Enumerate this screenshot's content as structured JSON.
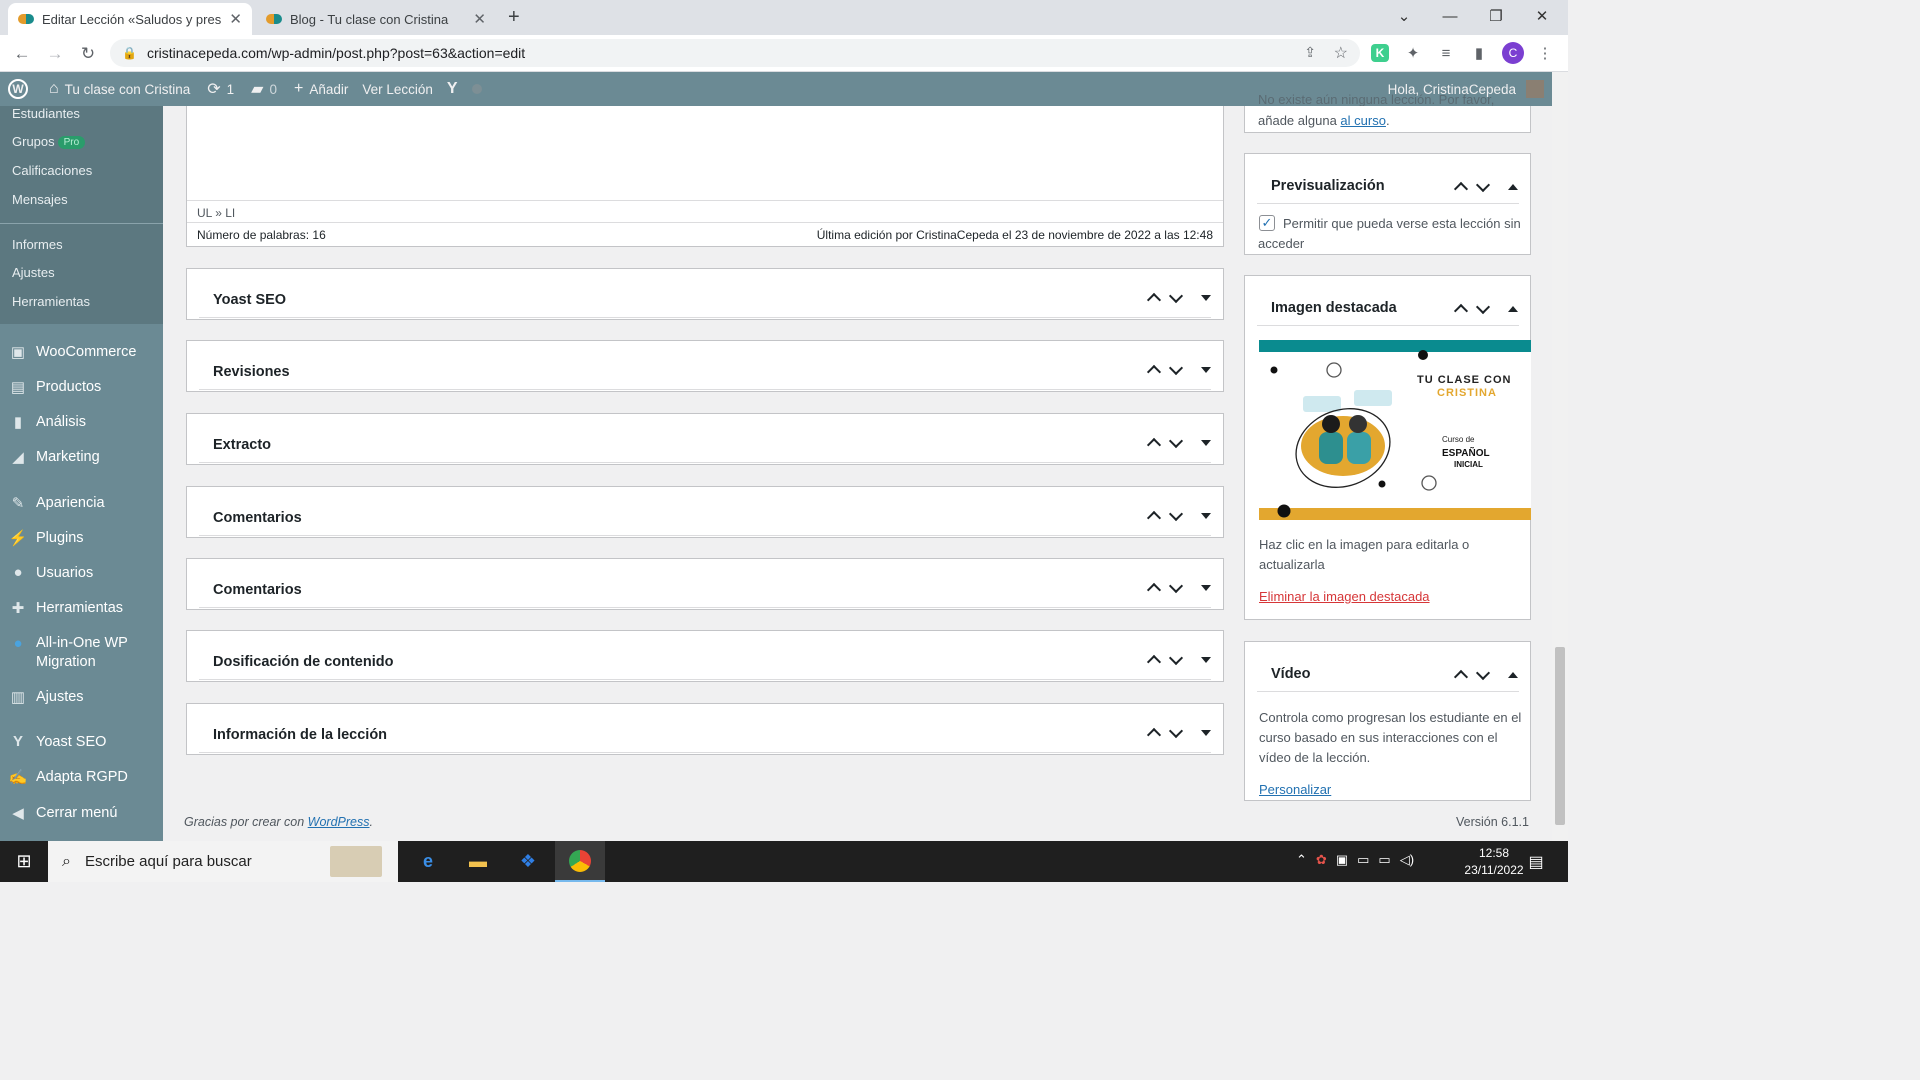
{
  "browser": {
    "tabs": [
      {
        "title": "Editar Lección «Saludos y presen",
        "active": true
      },
      {
        "title": "Blog - Tu clase con Cristina",
        "active": false
      }
    ],
    "url": "cristinacepeda.com/wp-admin/post.php?post=63&action=edit",
    "profile_initial": "C"
  },
  "adminbar": {
    "site": "Tu clase con Cristina",
    "updates": "1",
    "comments": "0",
    "add": "Añadir",
    "view": "Ver Lección",
    "greeting": "Hola, CristinaCepeda"
  },
  "sidebar": {
    "submenu": [
      "Estudiantes",
      "Grupos",
      "Calificaciones",
      "Mensajes",
      "Informes",
      "Ajustes",
      "Herramientas"
    ],
    "pro_badge": "Pro",
    "menu": [
      {
        "label": "WooCommerce",
        "icon": "woo-icon"
      },
      {
        "label": "Productos",
        "icon": "archive-icon"
      },
      {
        "label": "Análisis",
        "icon": "chart-icon"
      },
      {
        "label": "Marketing",
        "icon": "megaphone-icon"
      },
      {
        "label": "Apariencia",
        "icon": "brush-icon"
      },
      {
        "label": "Plugins",
        "icon": "plug-icon"
      },
      {
        "label": "Usuarios",
        "icon": "user-icon"
      },
      {
        "label": "Herramientas",
        "icon": "wrench-icon"
      },
      {
        "label": "All-in-One WP Migration",
        "icon": "circle-icon"
      },
      {
        "label": "Ajustes",
        "icon": "settings-icon"
      },
      {
        "label": "Yoast SEO",
        "icon": "yoast-icon"
      },
      {
        "label": "Adapta RGPD",
        "icon": "edit-icon"
      },
      {
        "label": "Cerrar menú",
        "icon": "collapse-icon"
      }
    ]
  },
  "editor": {
    "path": "UL » LI",
    "word_count": "Número de palabras: 16",
    "last_edit": "Última edición por CristinaCepeda el 23 de noviembre de 2022 a las 12:48"
  },
  "metaboxes": [
    "Yoast SEO",
    "Revisiones",
    "Extracto",
    "Comentarios",
    "Comentarios",
    "Dosificación de contenido",
    "Información de la lección"
  ],
  "side": {
    "top_text": "No existe aún ninguna lección. Por favor,",
    "top_text2": "añade alguna ",
    "top_link": "al curso",
    "preview": {
      "title": "Previsualización",
      "checkbox": "Permitir que pueda verse esta lección sin acceder",
      "checked": true
    },
    "featured": {
      "title": "Imagen destacada",
      "img_brand_1": "TU CLASE CON",
      "img_brand_2": "CRISTINA",
      "img_course_1": "Curso de",
      "img_course_2": "ESPAÑOL",
      "img_course_3": "INICIAL",
      "help": "Haz clic en la imagen para editarla o actualizarla",
      "remove": "Eliminar la imagen destacada"
    },
    "video": {
      "title": "Vídeo",
      "desc": "Controla como progresan los estudiante en el curso basado en sus interacciones con el vídeo de la lección.",
      "link": "Personalizar"
    }
  },
  "footer": {
    "thanks": "Gracias por crear con ",
    "wp": "WordPress",
    "version": "Versión 6.1.1"
  },
  "taskbar": {
    "search": "Escribe aquí para buscar",
    "time": "12:58",
    "date": "23/11/2022"
  },
  "colors": {
    "admin_bar": "#6b8a94",
    "link": "#2271b1",
    "remove": "#d63638",
    "teal": "#0a8b8f",
    "orange": "#e3a72f"
  }
}
